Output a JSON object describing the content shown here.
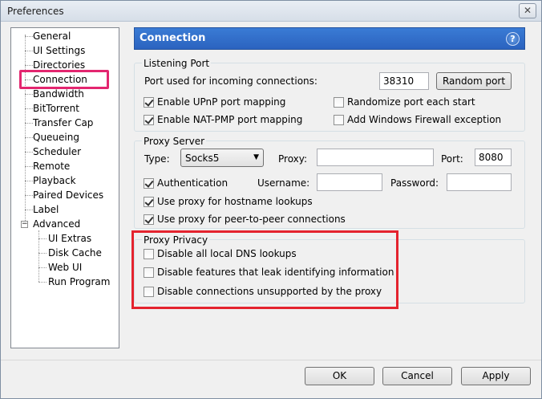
{
  "window": {
    "title": "Preferences",
    "close_glyph": "✕"
  },
  "tree": {
    "items": [
      "General",
      "UI Settings",
      "Directories",
      "Connection",
      "Bandwidth",
      "BitTorrent",
      "Transfer Cap",
      "Queueing",
      "Scheduler",
      "Remote",
      "Playback",
      "Paired Devices",
      "Label",
      "Advanced"
    ],
    "sub_items": [
      "UI Extras",
      "Disk Cache",
      "Web UI",
      "Run Program"
    ],
    "expander_glyph": "−"
  },
  "header": {
    "title": "Connection",
    "help_glyph": "?"
  },
  "listening": {
    "title": "Listening Port",
    "port_label": "Port used for incoming connections:",
    "port_value": "38310",
    "random_button": "Random port",
    "upnp": "Enable UPnP port mapping",
    "natpmp": "Enable NAT-PMP port mapping",
    "randomize": "Randomize port each start",
    "firewall": "Add Windows Firewall exception"
  },
  "proxy": {
    "title": "Proxy Server",
    "type_label": "Type:",
    "type_value": "Socks5",
    "proxy_label": "Proxy:",
    "proxy_value": "",
    "port_label": "Port:",
    "port_value": "8080",
    "auth": "Authentication",
    "username_label": "Username:",
    "password_label": "Password:",
    "hostname": "Use proxy for hostname lookups",
    "p2p": "Use proxy for peer-to-peer connections"
  },
  "privacy": {
    "title": "Proxy Privacy",
    "dns": "Disable all local DNS lookups",
    "leak": "Disable features that leak identifying information",
    "unsupported": "Disable connections unsupported by the proxy"
  },
  "buttons": {
    "ok": "OK",
    "cancel": "Cancel",
    "apply": "Apply"
  },
  "colors": {
    "header": "#2f6dc8",
    "highlight_pink": "#e3266f",
    "highlight_red": "#e4232e"
  }
}
